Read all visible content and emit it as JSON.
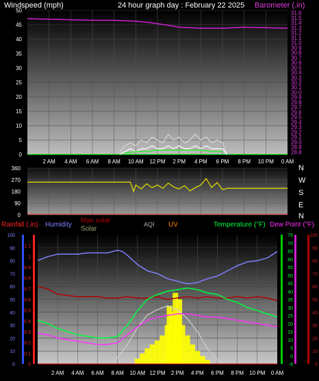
{
  "header": {
    "left_label": "Windspeed (mph)",
    "title": "24 hour graph day : February 22 2025",
    "right_label": "Barometer (.in)"
  },
  "time_axis": [
    "2 AM",
    "4 AM",
    "6 AM",
    "8 AM",
    "10 AM",
    "12 PM",
    "2 PM",
    "4 PM",
    "6 PM",
    "8 PM",
    "10 PM",
    "0 AM"
  ],
  "colors": {
    "windspeed": "#ffffff",
    "gust": "#d8d8d8",
    "avg_wind": "#00ff00",
    "barometer": "#d020d0",
    "direction": "#e8e000",
    "rainfall": "#ff2020",
    "humidity": "#8080ff",
    "max_solar": "#b00000",
    "solar": "#a0a070",
    "aqi": "#b0b0b0",
    "uv": "#ff8000",
    "temperature": "#00ff40",
    "dew_point": "#ff30ff"
  },
  "legend": {
    "rainfall": "Rainfall (.in)",
    "humidity": "Humidity",
    "max_solar": "Max solar",
    "solar": "Solar",
    "aqi": "AQI",
    "uv": "UV",
    "temperature": "Temperature (°F)",
    "dew_point": "Dew Point (°F)"
  },
  "compass": [
    "N",
    "W",
    "S",
    "E",
    "N"
  ],
  "chart_data": [
    {
      "type": "line",
      "name": "wind-barometer",
      "x_hours": [
        0,
        2,
        4,
        6,
        8,
        10,
        12,
        14,
        16,
        18,
        20,
        22,
        24
      ],
      "y_left_ticks": [
        0,
        5,
        10,
        15,
        20,
        25,
        30,
        35,
        40,
        45,
        50
      ],
      "y_left_range": [
        0,
        50
      ],
      "y_right_ticks": [
        28.8,
        28.9,
        29.0,
        29.1,
        29.2,
        29.3,
        29.4,
        29.5,
        29.6,
        29.7,
        29.8,
        29.9,
        30.0,
        30.1,
        30.2,
        30.3,
        30.4,
        30.5,
        30.6,
        30.7,
        30.8,
        30.9,
        31.0,
        31.1,
        31.2,
        31.3,
        31.4,
        31.5,
        31.6
      ],
      "y_right_range": [
        28.75,
        31.65
      ],
      "series": [
        {
          "name": "Barometer",
          "axis": "right",
          "x": [
            0,
            2,
            4,
            6,
            8,
            9,
            10,
            11,
            12,
            13,
            14,
            15,
            16,
            17,
            18,
            19,
            20,
            22,
            24
          ],
          "values": [
            31.48,
            31.47,
            31.46,
            31.45,
            31.45,
            31.44,
            31.43,
            31.41,
            31.38,
            31.35,
            31.31,
            31.3,
            31.29,
            31.29,
            31.29,
            31.3,
            31.31,
            31.3,
            31.29
          ]
        },
        {
          "name": "Gust",
          "axis": "left",
          "x": [
            8.5,
            9,
            9.5,
            10,
            10.5,
            11,
            11.5,
            12,
            12.5,
            13,
            13.5,
            14,
            14.5,
            15,
            15.5,
            16,
            16.5,
            17,
            17.5,
            18,
            18.4
          ],
          "values": [
            1,
            3,
            4,
            3,
            5,
            4,
            6,
            5,
            4,
            7,
            5,
            6,
            4,
            5,
            7,
            5,
            6,
            4,
            5,
            4,
            0
          ]
        },
        {
          "name": "Windspeed",
          "axis": "left",
          "x": [
            8.5,
            9,
            9.5,
            10,
            10.5,
            11,
            11.5,
            12,
            12.5,
            13,
            13.5,
            14,
            14.5,
            15,
            15.5,
            16,
            16.5,
            17,
            17.5,
            18,
            18.4
          ],
          "values": [
            0,
            1,
            2,
            1,
            2,
            2,
            3,
            2,
            2,
            3,
            2,
            3,
            2,
            2,
            3,
            2,
            3,
            2,
            2,
            2,
            0
          ]
        },
        {
          "name": "Average wind",
          "axis": "left",
          "x": [
            9,
            10,
            11,
            12,
            13,
            14,
            15,
            16,
            17,
            18
          ],
          "values": [
            0.5,
            1,
            1,
            1.5,
            1.5,
            1.5,
            1.5,
            1.5,
            1,
            1
          ]
        }
      ]
    },
    {
      "type": "line",
      "name": "wind-direction",
      "y_ticks": [
        0,
        90,
        180,
        270,
        360
      ],
      "y_range": [
        0,
        360
      ],
      "series": [
        {
          "name": "Direction",
          "x": [
            0,
            2,
            4,
            6,
            8,
            9.5,
            9.8,
            10,
            10.5,
            11,
            11.5,
            12,
            12.5,
            13,
            13.5,
            14,
            14.5,
            15,
            15.5,
            16,
            16.5,
            17,
            17.5,
            18,
            18.5,
            20,
            22,
            24
          ],
          "values": [
            252,
            252,
            252,
            252,
            252,
            252,
            180,
            230,
            200,
            240,
            210,
            230,
            205,
            245,
            215,
            200,
            225,
            185,
            210,
            230,
            280,
            210,
            250,
            195,
            205,
            205,
            205,
            205
          ]
        }
      ]
    },
    {
      "type": "line",
      "name": "climate",
      "y_humidity_ticks": [
        0,
        10,
        20,
        30,
        40,
        50,
        60,
        70,
        80,
        90,
        100
      ],
      "y_rain_ticks": [
        0,
        0.1,
        0.2,
        0.3,
        0.4,
        0.5,
        0.6,
        0.7,
        0.8,
        0.9,
        1,
        1.1
      ],
      "y_temp_ticks": [
        -5,
        0,
        5,
        10,
        15,
        20,
        25,
        30,
        35,
        40,
        45,
        50,
        55,
        60,
        65,
        70,
        75
      ],
      "y_temp_range": [
        -5,
        75
      ],
      "y_solar_ticks": [
        0,
        10,
        20,
        30,
        40,
        50,
        60,
        70,
        80,
        90,
        100
      ],
      "series": [
        {
          "name": "Humidity",
          "axis": "humidity",
          "x": [
            0,
            1,
            2,
            3,
            4,
            5,
            6,
            7,
            8,
            8.5,
            9,
            10,
            11,
            12,
            13,
            14,
            15,
            16,
            17,
            18,
            19,
            20,
            21,
            22,
            23,
            24
          ],
          "values": [
            80,
            83,
            85,
            85,
            85,
            86,
            86,
            86,
            88,
            87,
            84,
            77,
            72,
            70,
            66,
            64,
            62,
            63,
            66,
            68,
            72,
            76,
            79,
            80,
            82,
            87
          ]
        },
        {
          "name": "Temperature",
          "axis": "temp",
          "x": [
            0,
            1,
            2,
            3,
            4,
            5,
            6,
            7,
            8,
            9,
            10,
            11,
            12,
            13,
            14,
            15,
            16,
            17,
            18,
            19,
            20,
            21,
            22,
            23,
            24
          ],
          "values": [
            22,
            20,
            17,
            15,
            13,
            12,
            11,
            11,
            12,
            19,
            28,
            35,
            38,
            40,
            41,
            42,
            41,
            39,
            38,
            35,
            33,
            30,
            28,
            26,
            24
          ]
        },
        {
          "name": "Dew Point",
          "axis": "temp",
          "x": [
            0,
            1,
            2,
            3,
            4,
            5,
            6,
            7,
            8,
            9,
            10,
            11,
            12,
            13,
            14,
            15,
            16,
            17,
            18,
            19,
            20,
            21,
            22,
            23,
            24
          ],
          "values": [
            14,
            13,
            11,
            10,
            9,
            8,
            7,
            7,
            8,
            13,
            18,
            22,
            24,
            25,
            26,
            26,
            25,
            24,
            24,
            23,
            22,
            21,
            20,
            19,
            18
          ]
        },
        {
          "name": "Max solar",
          "axis": "humidity",
          "x": [
            0,
            1,
            2,
            3,
            4,
            5,
            6,
            7,
            8,
            9,
            10,
            11,
            12,
            13,
            14,
            15,
            16,
            17,
            18,
            19,
            20,
            21,
            22,
            23,
            24
          ],
          "values": [
            60,
            58,
            54,
            53,
            52,
            52,
            52,
            51,
            51,
            52,
            51,
            51,
            52,
            50,
            51,
            52,
            51,
            52,
            51,
            51,
            52,
            51,
            52,
            51,
            49
          ]
        },
        {
          "name": "Solar",
          "axis": "humidity",
          "x": [
            7.5,
            8,
            9,
            10,
            11,
            12,
            13,
            14,
            15,
            16,
            17,
            18,
            18.5
          ],
          "values": [
            0,
            5,
            15,
            28,
            38,
            42,
            45,
            42,
            35,
            25,
            12,
            3,
            0
          ]
        },
        {
          "name": "Solar bars",
          "axis": "solar",
          "x": [
            10,
            10.5,
            11,
            11.5,
            12,
            12.5,
            13,
            13.2,
            13.5,
            13.8,
            14,
            14.2,
            14.5,
            15,
            15.5,
            16,
            16.5,
            17
          ],
          "values": [
            4,
            8,
            12,
            15,
            18,
            22,
            30,
            45,
            40,
            55,
            38,
            50,
            30,
            22,
            15,
            10,
            6,
            3
          ]
        },
        {
          "name": "Rainfall",
          "axis": "rain",
          "x": [
            0,
            24
          ],
          "values": [
            0,
            0
          ]
        }
      ]
    }
  ]
}
